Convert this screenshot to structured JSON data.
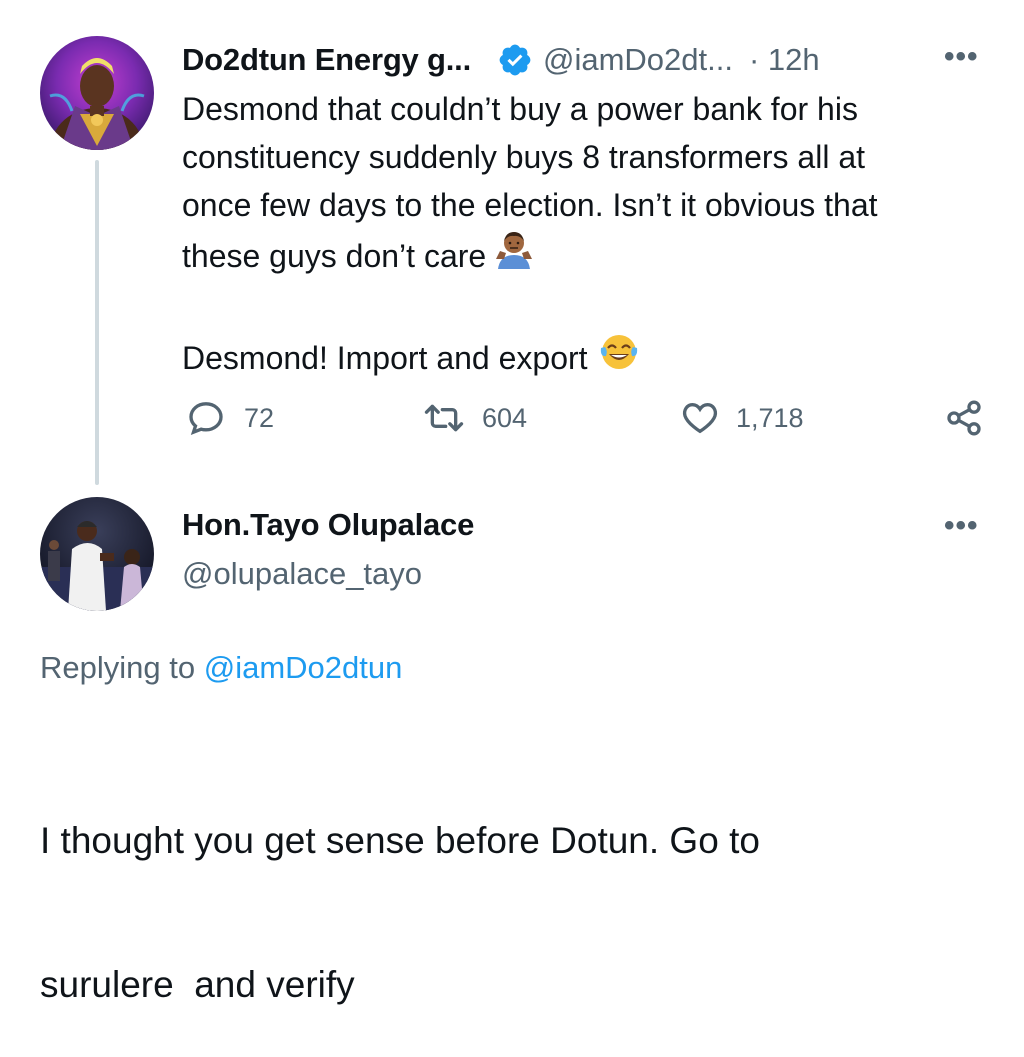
{
  "tweet": {
    "display_name": "Do2dtun Energy g...",
    "handle": "@iamDo2dt...",
    "time": "· 12h",
    "verified": true,
    "text_lines": [
      "Desmond that couldn’t buy a power bank for his",
      "constituency suddenly buys 8 transformers all at",
      "once few days to the election. Isn’t it obvious that",
      "these guys don’t care"
    ],
    "text_line_2": "Desmond! Import and export",
    "emoji_1": "person-shrugging-emoji",
    "emoji_2": "face-with-tears-of-joy-emoji",
    "actions": {
      "reply_count": "72",
      "retweet_count": "604",
      "like_count": "1,718"
    },
    "more_label": "•••"
  },
  "reply": {
    "display_name": "Hon.Tayo Olupalace",
    "handle": "@olupalace_tayo",
    "more_label": "•••",
    "replying_prefix": "Replying to",
    "replying_handle": "@iamDo2dtun",
    "text_lines": [
      "I thought you get sense before Dotun. Go to",
      "surulere  and verify"
    ]
  },
  "colors": {
    "text": "#0f1419",
    "secondary": "#536471",
    "link": "#1d9bf0",
    "verified": "#1d9bf0",
    "thread_line": "#cfd9de"
  }
}
